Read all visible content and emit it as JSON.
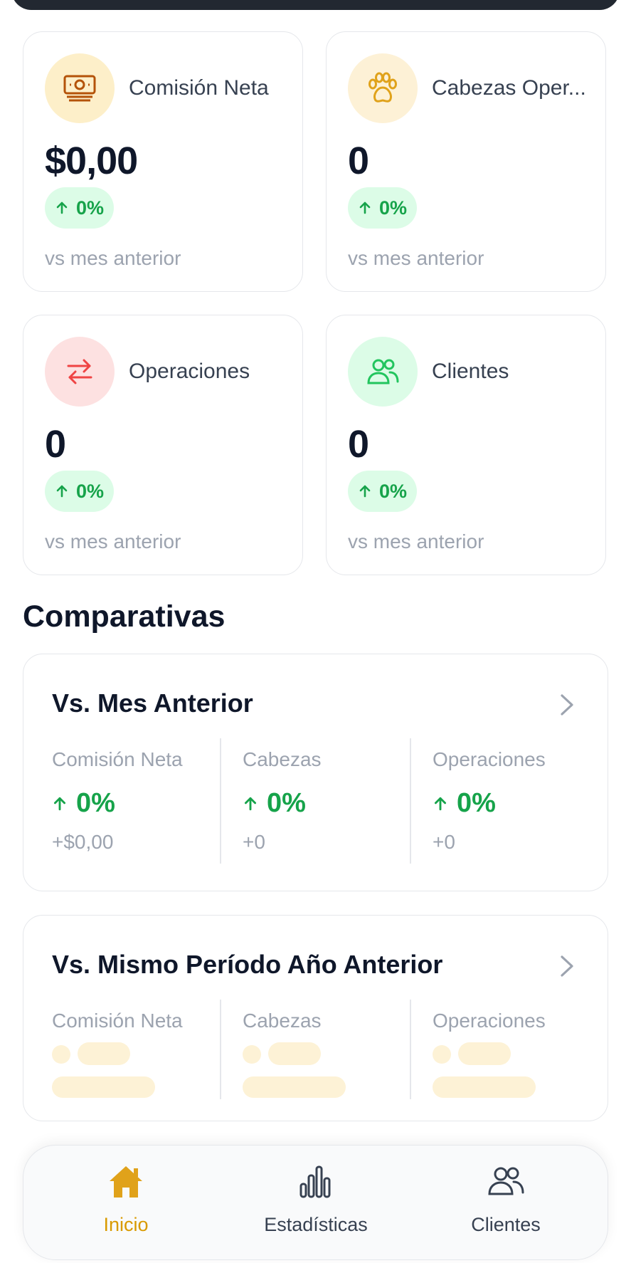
{
  "stats": [
    {
      "label": "Comisión Neta",
      "value": "$0,00",
      "trend": "0%",
      "sub": "vs mes anterior",
      "icon": "money-icon",
      "icon_bg": "#fdefc9",
      "icon_color": "#b45309"
    },
    {
      "label": "Cabezas Oper...",
      "value": "0",
      "trend": "0%",
      "sub": "vs mes anterior",
      "icon": "paw-icon",
      "icon_bg": "#fdf1d6",
      "icon_color": "#e0a21a"
    },
    {
      "label": "Operaciones",
      "value": "0",
      "trend": "0%",
      "sub": "vs mes anterior",
      "icon": "swap-arrows-icon",
      "icon_bg": "#fde1e1",
      "icon_color": "#ef4444"
    },
    {
      "label": "Clientes",
      "value": "0",
      "trend": "0%",
      "sub": "vs mes anterior",
      "icon": "users-icon",
      "icon_bg": "#dcfce7",
      "icon_color": "#22c55e"
    }
  ],
  "section_title": "Comparativas",
  "comparisons": [
    {
      "title": "Vs. Mes Anterior",
      "columns": [
        {
          "label": "Comisión Neta",
          "pct": "0%",
          "delta": "+$0,00"
        },
        {
          "label": "Cabezas",
          "pct": "0%",
          "delta": "+0"
        },
        {
          "label": "Operaciones",
          "pct": "0%",
          "delta": "+0"
        }
      ]
    },
    {
      "title": "Vs. Mismo Período Año Anterior",
      "loading": true,
      "columns": [
        {
          "label": "Comisión Neta"
        },
        {
          "label": "Cabezas"
        },
        {
          "label": "Operaciones"
        }
      ]
    }
  ],
  "nav": [
    {
      "label": "Inicio",
      "icon": "home-icon",
      "active": true
    },
    {
      "label": "Estadísticas",
      "icon": "bar-chart-icon",
      "active": false
    },
    {
      "label": "Clientes",
      "icon": "users-icon",
      "active": false
    }
  ],
  "colors": {
    "accent": "#d99a00",
    "positive": "#16a34a",
    "positive_bg": "#dcfce7",
    "skeleton": "#fdf2d6"
  }
}
